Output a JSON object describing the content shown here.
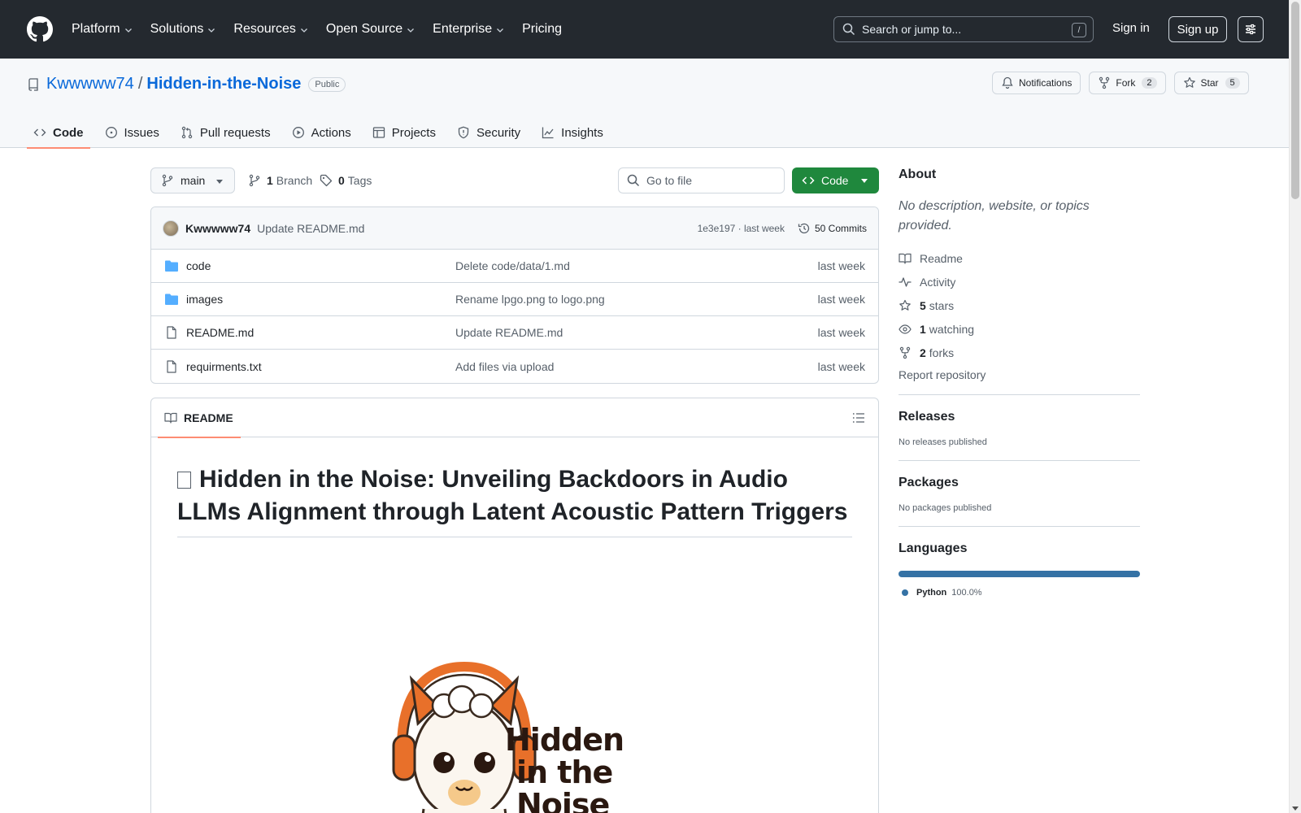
{
  "header": {
    "nav": [
      {
        "label": "Platform",
        "has_menu": true
      },
      {
        "label": "Solutions",
        "has_menu": true
      },
      {
        "label": "Resources",
        "has_menu": true
      },
      {
        "label": "Open Source",
        "has_menu": true
      },
      {
        "label": "Enterprise",
        "has_menu": true
      },
      {
        "label": "Pricing",
        "has_menu": false
      }
    ],
    "search_placeholder": "Search or jump to...",
    "search_shortcut": "/",
    "sign_in": "Sign in",
    "sign_up": "Sign up"
  },
  "repo": {
    "owner": "Kwwwww74",
    "separator": "/",
    "name": "Hidden-in-the-Noise",
    "visibility": "Public",
    "notifications_label": "Notifications",
    "fork_label": "Fork",
    "fork_count": "2",
    "star_label": "Star",
    "star_count": "5",
    "tabs": [
      {
        "label": "Code",
        "icon": "code-icon",
        "active": true
      },
      {
        "label": "Issues",
        "icon": "issue-icon",
        "active": false
      },
      {
        "label": "Pull requests",
        "icon": "pull-request-icon",
        "active": false
      },
      {
        "label": "Actions",
        "icon": "play-icon",
        "active": false
      },
      {
        "label": "Projects",
        "icon": "table-icon",
        "active": false
      },
      {
        "label": "Security",
        "icon": "shield-icon",
        "active": false
      },
      {
        "label": "Insights",
        "icon": "graph-icon",
        "active": false
      }
    ]
  },
  "toolbar": {
    "branch": "main",
    "branch_count": "1",
    "branch_label": "Branch",
    "tag_count": "0",
    "tag_label": "Tags",
    "goto_placeholder": "Go to file",
    "code_button": "Code"
  },
  "commit": {
    "author": "Kwwwww74",
    "message": "Update README.md",
    "hash_time": "1e3e197 · last week",
    "commits_label": "50 Commits"
  },
  "files": [
    {
      "name": "code",
      "type": "folder",
      "message": "Delete code/data/1.md",
      "date": "last week"
    },
    {
      "name": "images",
      "type": "folder",
      "message": "Rename lpgo.png to logo.png",
      "date": "last week"
    },
    {
      "name": "README.md",
      "type": "file",
      "message": "Update README.md",
      "date": "last week"
    },
    {
      "name": "requirments.txt",
      "type": "file",
      "message": "Add files via upload",
      "date": "last week"
    }
  ],
  "readme": {
    "tab_label": "README",
    "heading": "Hidden in the Noise: Unveiling Backdoors in Audio LLMs Alignment through Latent Acoustic Pattern Triggers",
    "logo_lines": [
      "Hidden",
      "in the",
      "Noise"
    ]
  },
  "sidebar": {
    "about_title": "About",
    "about_desc": "No description, website, or topics provided.",
    "items": [
      {
        "icon": "book-icon",
        "count": "",
        "label": "Readme"
      },
      {
        "icon": "pulse-icon",
        "count": "",
        "label": "Activity"
      },
      {
        "icon": "star-icon",
        "count": "5",
        "label": "stars"
      },
      {
        "icon": "eye-icon",
        "count": "1",
        "label": "watching"
      },
      {
        "icon": "fork-icon",
        "count": "2",
        "label": "forks"
      }
    ],
    "report": "Report repository",
    "releases_title": "Releases",
    "releases_text": "No releases published",
    "packages_title": "Packages",
    "packages_text": "No packages published",
    "languages_title": "Languages",
    "languages": [
      {
        "name": "Python",
        "percent": "100.0%",
        "color": "#3572A5"
      }
    ]
  },
  "colors": {
    "header_bg": "#24292f",
    "link": "#0969da",
    "primary_button": "#1f883d",
    "tab_underline": "#fd8c73"
  }
}
